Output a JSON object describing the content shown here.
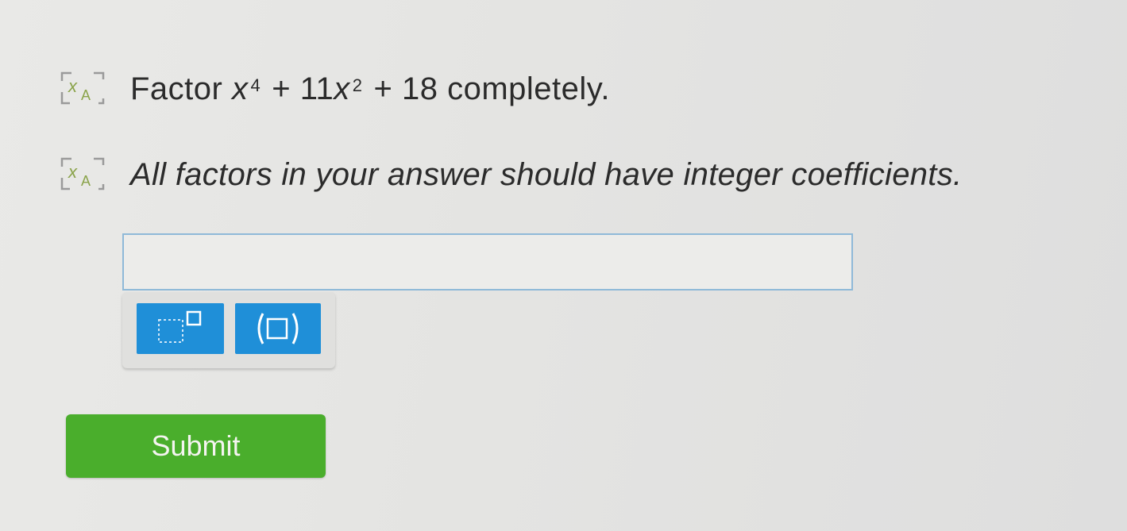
{
  "question": {
    "prefix": "Factor",
    "var1": "x",
    "exp1": "4",
    "plus1": "+",
    "coef": "11",
    "var2": "x",
    "exp2": "2",
    "plus2": "+",
    "const": "18",
    "suffix": "completely."
  },
  "instruction": {
    "text": "All factors in your answer should have integer coefficients."
  },
  "answer": {
    "value": "",
    "placeholder": ""
  },
  "toolbar": {
    "superscript_icon": "superscript-icon",
    "parentheses_icon": "parentheses-icon"
  },
  "submit": {
    "label": "Submit"
  },
  "colors": {
    "accent_blue": "#1f8fd8",
    "submit_green": "#4aae2c",
    "input_border": "#8fb9d8"
  }
}
